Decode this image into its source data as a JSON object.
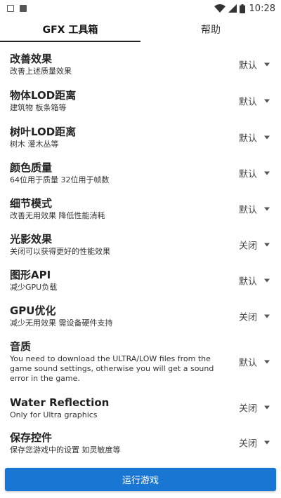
{
  "status_bar": {
    "time": "10:28",
    "left_icons": [
      "gallery-icon",
      "notification-icon"
    ],
    "right_icons": [
      "wifi-icon",
      "signal-icon",
      "battery-icon"
    ]
  },
  "tabs": [
    {
      "label": "GFX 工具箱",
      "active": true
    },
    {
      "label": "帮助",
      "active": false
    }
  ],
  "settings": [
    {
      "title": "改善效果",
      "desc": "改善上述质量效果",
      "value": "默认"
    },
    {
      "title": "物体LOD距离",
      "desc": "建筑物 板条箱等",
      "value": "默认"
    },
    {
      "title": "树叶LOD距离",
      "desc": "树木 灌木丛等",
      "value": "默认"
    },
    {
      "title": "颜色质量",
      "desc": "64位用于质量 32位用于帧数",
      "value": "默认"
    },
    {
      "title": "细节模式",
      "desc": "改善无用效果 降低性能消耗",
      "value": "默认"
    },
    {
      "title": "光影效果",
      "desc": "关闭可以获得更好的性能效果",
      "value": "关闭"
    },
    {
      "title": "图形API",
      "desc": "减少GPU负载",
      "value": "默认"
    },
    {
      "title": "GPU优化",
      "desc": "减少无用效果 需设备硬件支持",
      "value": "关闭"
    },
    {
      "title": "音质",
      "desc": "You need to download the ULTRA/LOW files from the game sound settings, otherwise you will get a sound error in the game.",
      "value": "默认"
    },
    {
      "title": "Water Reflection",
      "desc": "Only for Ultra graphics",
      "value": "关闭"
    },
    {
      "title": "保存控件",
      "desc": "保存您游戏中的设置 如灵敏度等",
      "value": "关闭"
    }
  ],
  "run_button": {
    "label": "运行游戏"
  },
  "colors": {
    "accent": "#1976d2",
    "tab_indicator": "#222222"
  }
}
